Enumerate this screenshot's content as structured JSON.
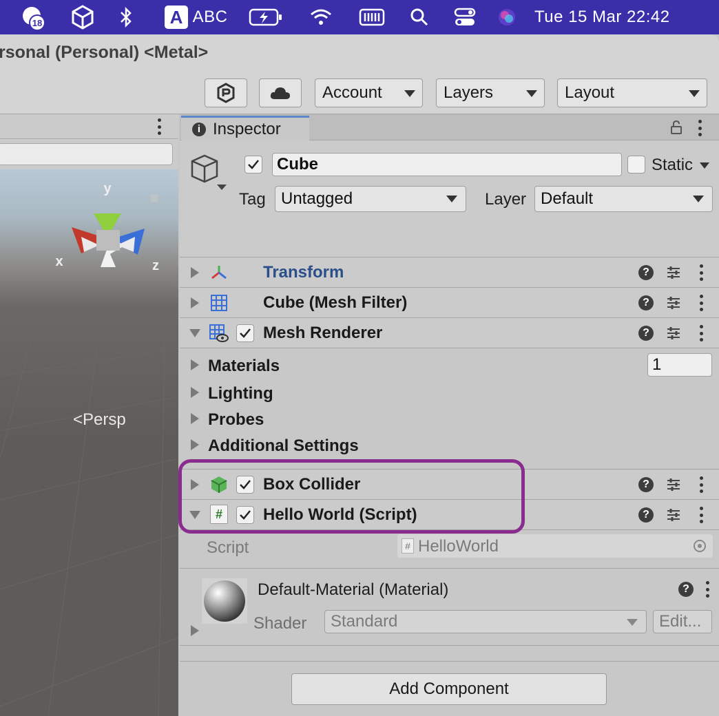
{
  "menubar": {
    "notification_count": "18",
    "input_letter": "A",
    "input_source": "ABC",
    "datetime": "Tue 15 Mar  22:42"
  },
  "window": {
    "title": "rsonal (Personal) <Metal>"
  },
  "toolbar": {
    "account_label": "Account",
    "layers_label": "Layers",
    "layout_label": "Layout"
  },
  "scene": {
    "gizmo_y": "y",
    "gizmo_x": "x",
    "gizmo_z": "z",
    "projection_label": "Persp"
  },
  "inspector": {
    "tab_label": "Inspector",
    "object_name": "Cube",
    "static_label": "Static",
    "tag_label": "Tag",
    "tag_value": "Untagged",
    "layer_label": "Layer",
    "layer_value": "Default",
    "components": [
      {
        "name": "Transform",
        "color": "#2a4f8a"
      },
      {
        "name": "Cube (Mesh Filter)"
      },
      {
        "name": "Mesh Renderer"
      },
      {
        "name": "Box Collider"
      },
      {
        "name": "Hello World (Script)"
      }
    ],
    "mesh_renderer_props": [
      "Materials",
      "Lighting",
      "Probes",
      "Additional Settings"
    ],
    "materials_count": "1",
    "script_label": "Script",
    "script_value": "HelloWorld",
    "material": {
      "name": "Default-Material (Material)",
      "shader_label": "Shader",
      "shader_value": "Standard",
      "edit_label": "Edit..."
    },
    "add_component_label": "Add Component"
  },
  "colors": {
    "menubar": "#3a2fa8",
    "highlight": "#8a2b8e",
    "tab_accent": "#5c86c7"
  }
}
